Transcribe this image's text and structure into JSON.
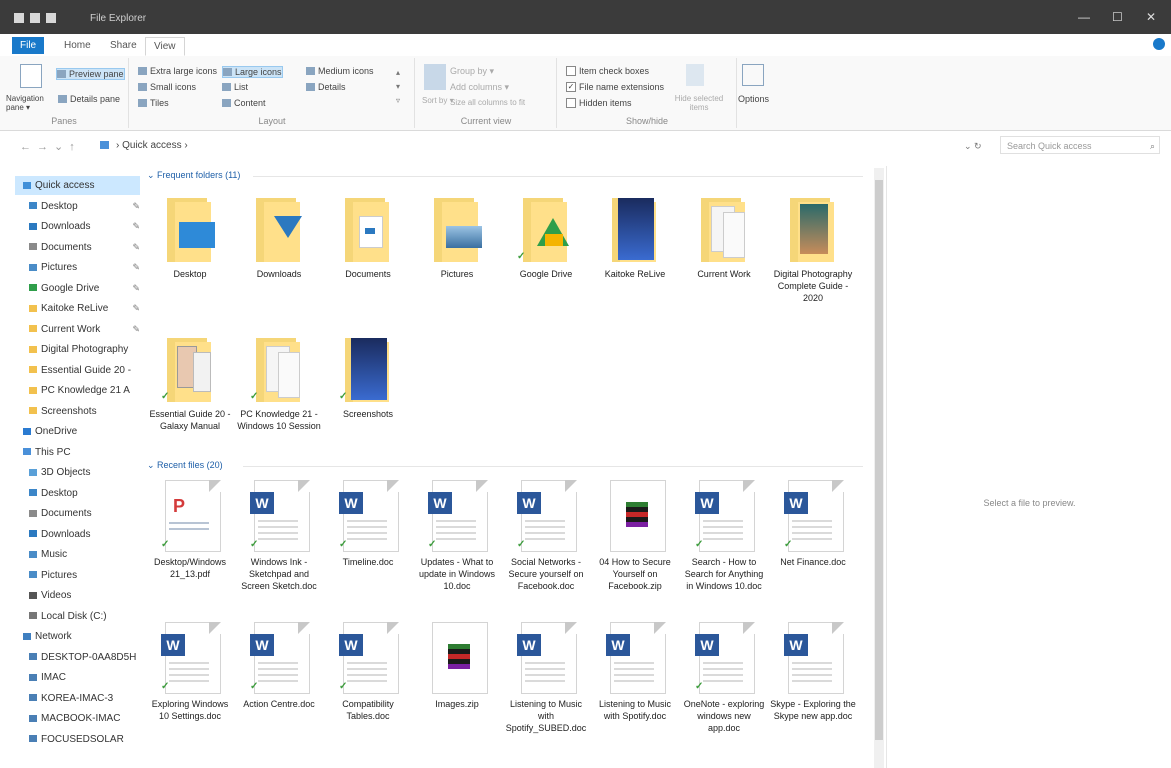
{
  "window": {
    "title": "File Explorer",
    "minimize": "—",
    "maximize": "☐",
    "close": "✕"
  },
  "ribbon_tabs": [
    "File",
    "Home",
    "Share",
    "View"
  ],
  "ribbon": {
    "panes": {
      "nav_pane": "Navigation pane ▾",
      "preview_pane": "Preview pane",
      "details_pane": "Details pane",
      "label": "Panes"
    },
    "layout": {
      "items": [
        "Extra large icons",
        "Large icons",
        "Medium icons",
        "Small icons",
        "List",
        "Details",
        "Tiles",
        "Content"
      ],
      "selected": "Large icons",
      "label": "Layout"
    },
    "current_view": {
      "sort": "Sort by ▾",
      "group": "Group by ▾",
      "add_columns": "Add columns ▾",
      "size_columns": "Size all columns to fit",
      "label": "Current view"
    },
    "show_hide": {
      "item_checkboxes": "Item check boxes",
      "file_extensions": "File name extensions",
      "hidden_items": "Hidden items",
      "hide_selected": "Hide selected items",
      "label": "Show/hide"
    },
    "options": "Options"
  },
  "address": {
    "path": "Quick access",
    "search_placeholder": "Search Quick access"
  },
  "sidebar": {
    "items": [
      {
        "label": "Quick access",
        "color": "#3f8fd8",
        "pin": false,
        "indent": false,
        "selected": true
      },
      {
        "label": "Desktop",
        "color": "#3c86c8",
        "pin": true,
        "indent": true
      },
      {
        "label": "Downloads",
        "color": "#2b79c0",
        "pin": true,
        "indent": true
      },
      {
        "label": "Documents",
        "color": "#8a8a8a",
        "pin": true,
        "indent": true
      },
      {
        "label": "Pictures",
        "color": "#4a8cc7",
        "pin": true,
        "indent": true
      },
      {
        "label": "Google Drive",
        "color": "#2f9e4a",
        "pin": true,
        "indent": true
      },
      {
        "label": "Kaitoke ReLive",
        "color": "#f2c14e",
        "pin": true,
        "indent": true
      },
      {
        "label": "Current Work",
        "color": "#f2c14e",
        "pin": true,
        "indent": true
      },
      {
        "label": "Digital Photography",
        "color": "#f2c14e",
        "pin": false,
        "indent": true
      },
      {
        "label": "Essential Guide 20 -",
        "color": "#f2c14e",
        "pin": false,
        "indent": true
      },
      {
        "label": "PC Knowledge 21 A",
        "color": "#f2c14e",
        "pin": false,
        "indent": true
      },
      {
        "label": "Screenshots",
        "color": "#f2c14e",
        "pin": false,
        "indent": true
      },
      {
        "label": "OneDrive",
        "color": "#2b7bd1",
        "pin": false,
        "indent": false
      },
      {
        "label": "This PC",
        "color": "#4a90d9",
        "pin": false,
        "indent": false
      },
      {
        "label": "3D Objects",
        "color": "#5aa0d8",
        "pin": false,
        "indent": true
      },
      {
        "label": "Desktop",
        "color": "#3c86c8",
        "pin": false,
        "indent": true
      },
      {
        "label": "Documents",
        "color": "#8a8a8a",
        "pin": false,
        "indent": true
      },
      {
        "label": "Downloads",
        "color": "#2b79c0",
        "pin": false,
        "indent": true
      },
      {
        "label": "Music",
        "color": "#4a8cc7",
        "pin": false,
        "indent": true
      },
      {
        "label": "Pictures",
        "color": "#4a8cc7",
        "pin": false,
        "indent": true
      },
      {
        "label": "Videos",
        "color": "#555555",
        "pin": false,
        "indent": true
      },
      {
        "label": "Local Disk (C:)",
        "color": "#777777",
        "pin": false,
        "indent": true
      },
      {
        "label": "Network",
        "color": "#3f7fc0",
        "pin": false,
        "indent": false
      },
      {
        "label": "DESKTOP-0AA8D5H",
        "color": "#4a7fb5",
        "pin": false,
        "indent": true
      },
      {
        "label": "IMAC",
        "color": "#4a7fb5",
        "pin": false,
        "indent": true
      },
      {
        "label": "KOREA-IMAC-3",
        "color": "#4a7fb5",
        "pin": false,
        "indent": true
      },
      {
        "label": "MACBOOK-IMAC",
        "color": "#4a7fb5",
        "pin": false,
        "indent": true
      },
      {
        "label": "FOCUSEDSOLAR",
        "color": "#4a7fb5",
        "pin": false,
        "indent": true
      }
    ]
  },
  "frequent": {
    "header": "Frequent folders (11)",
    "items": [
      {
        "name": "Desktop",
        "overlay": "desktop",
        "synced": false
      },
      {
        "name": "Downloads",
        "overlay": "download",
        "synced": false
      },
      {
        "name": "Documents",
        "overlay": "doc",
        "synced": false
      },
      {
        "name": "Pictures",
        "overlay": "picture",
        "synced": false
      },
      {
        "name": "Google Drive",
        "overlay": "gdrive",
        "synced": true
      },
      {
        "name": "Kaitoke ReLive",
        "overlay": "dark",
        "synced": false
      },
      {
        "name": "Current Work",
        "overlay": "pages",
        "synced": false
      },
      {
        "name": "Digital Photography Complete Guide - 2020",
        "overlay": "photo",
        "synced": false
      },
      {
        "name": "Essential Guide 20 - Galaxy Manual",
        "overlay": "phone",
        "synced": true
      },
      {
        "name": "PC Knowledge 21 - Windows 10 Session",
        "overlay": "pages",
        "synced": true
      },
      {
        "name": "Screenshots",
        "overlay": "dark",
        "synced": true
      }
    ]
  },
  "recent": {
    "header": "Recent files (20)",
    "items": [
      {
        "name": "Desktop/Windows 21_13.pdf",
        "type": "pdf",
        "synced": true
      },
      {
        "name": "Windows Ink - Sketchpad and Screen Sketch.doc",
        "type": "word",
        "synced": true
      },
      {
        "name": "Timeline.doc",
        "type": "word",
        "synced": true
      },
      {
        "name": "Updates - What to update in Windows 10.doc",
        "type": "word",
        "synced": true
      },
      {
        "name": "Social Networks - Secure yourself on Facebook.doc",
        "type": "word",
        "synced": true
      },
      {
        "name": "04 How to Secure Yourself on Facebook.zip",
        "type": "zip",
        "synced": false
      },
      {
        "name": "Search - How to Search for Anything in Windows 10.doc",
        "type": "word",
        "synced": true
      },
      {
        "name": "Net Finance.doc",
        "type": "word",
        "synced": true
      },
      {
        "name": "Exploring Windows 10 Settings.doc",
        "type": "word",
        "synced": true
      },
      {
        "name": "Action Centre.doc",
        "type": "word",
        "synced": true
      },
      {
        "name": "Compatibility Tables.doc",
        "type": "word",
        "synced": true
      },
      {
        "name": "Images.zip",
        "type": "zip",
        "synced": false
      },
      {
        "name": "Listening to Music with Spotify_SUBED.doc",
        "type": "word",
        "synced": false
      },
      {
        "name": "Listening to Music with Spotify.doc",
        "type": "word",
        "synced": false
      },
      {
        "name": "OneNote - exploring windows new app.doc",
        "type": "word",
        "synced": true
      },
      {
        "name": "Skype - Exploring the Skype new app.doc",
        "type": "word",
        "synced": false
      }
    ]
  },
  "preview": {
    "message": "Select a file to preview."
  }
}
